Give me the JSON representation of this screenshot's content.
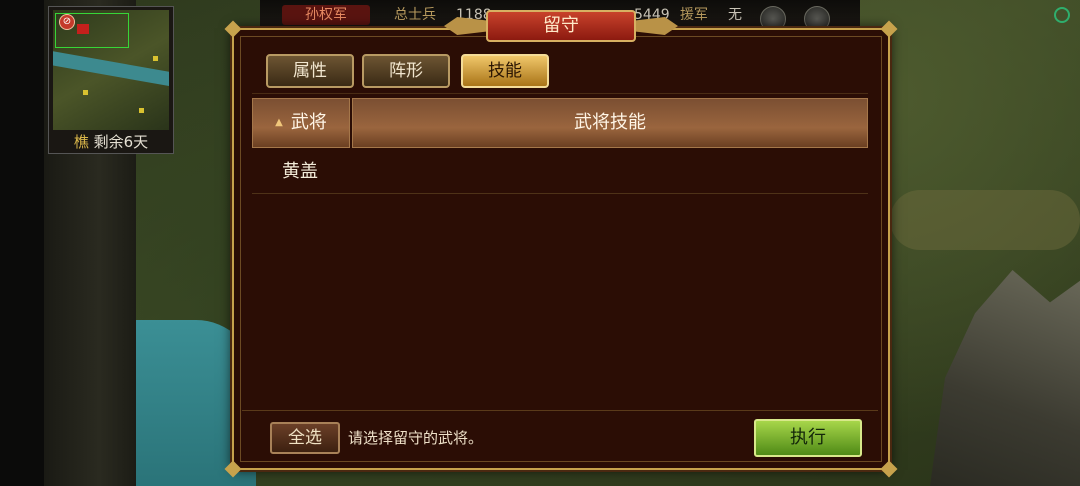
{
  "minimap": {
    "caption_tag": "樵",
    "caption_text": "剩余6天",
    "forbid_symbol": "⊘"
  },
  "topbar": {
    "army": "孙权军",
    "troops_label": "总士兵",
    "troops_value": "1188",
    "item3": "",
    "count_value": "5449",
    "reinforce_label": "援军",
    "reinforce_value": "无"
  },
  "dialog": {
    "title": "留守",
    "tabs": [
      {
        "label": "属性",
        "active": false
      },
      {
        "label": "阵形",
        "active": false
      },
      {
        "label": "技能",
        "active": true
      }
    ],
    "table": {
      "sort_indicator": "▲",
      "columns": [
        "武将",
        "武将技能"
      ],
      "rows": [
        {
          "general": "黄盖",
          "skill": ""
        }
      ]
    },
    "select_all_label": "全选",
    "hint": "请选择留守的武将。",
    "execute_label": "执行"
  },
  "colors": {
    "dialog_bg": "#2b0d05",
    "gold_border": "#c7a24c",
    "active_tab": "#f0c76a",
    "execute_green": "#7bb233",
    "army_red": "#5a1410"
  }
}
